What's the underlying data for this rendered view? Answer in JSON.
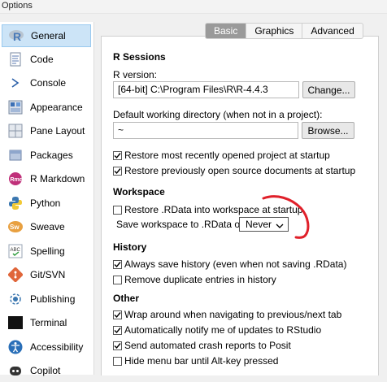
{
  "window": {
    "title": "Options"
  },
  "sidebar": {
    "items": [
      {
        "label": "General",
        "icon": "r-logo-icon",
        "selected": true
      },
      {
        "label": "Code",
        "icon": "code-document-icon"
      },
      {
        "label": "Console",
        "icon": "console-prompt-icon"
      },
      {
        "label": "Appearance",
        "icon": "appearance-palette-icon"
      },
      {
        "label": "Pane Layout",
        "icon": "pane-layout-icon"
      },
      {
        "label": "Packages",
        "icon": "package-box-icon"
      },
      {
        "label": "R Markdown",
        "icon": "rmd-icon"
      },
      {
        "label": "Python",
        "icon": "python-icon"
      },
      {
        "label": "Sweave",
        "icon": "sweave-icon"
      },
      {
        "label": "Spelling",
        "icon": "spelling-abc-icon"
      },
      {
        "label": "Git/SVN",
        "icon": "git-icon"
      },
      {
        "label": "Publishing",
        "icon": "publishing-icon"
      },
      {
        "label": "Terminal",
        "icon": "terminal-icon"
      },
      {
        "label": "Accessibility",
        "icon": "accessibility-icon"
      },
      {
        "label": "Copilot",
        "icon": "copilot-icon"
      }
    ]
  },
  "tabs": [
    {
      "label": "Basic",
      "active": true
    },
    {
      "label": "Graphics",
      "active": false
    },
    {
      "label": "Advanced",
      "active": false
    }
  ],
  "r_sessions": {
    "title": "R Sessions",
    "r_version_label": "R version:",
    "r_version_value": "[64-bit] C:\\Program Files\\R\\R-4.4.3",
    "change_button": "Change...",
    "working_dir_label": "Default working directory (when not in a project):",
    "working_dir_value": "~",
    "browse_button": "Browse...",
    "restore_project": {
      "label": "Restore most recently opened project at startup",
      "checked": true
    },
    "restore_documents": {
      "label": "Restore previously open source documents at startup",
      "checked": true
    }
  },
  "workspace": {
    "title": "Workspace",
    "restore_rdata": {
      "label": "Restore .RData into workspace at startup",
      "checked": false
    },
    "save_label": "Save workspace to .RData on exit:",
    "save_value": "Never"
  },
  "history": {
    "title": "History",
    "always_save": {
      "label": "Always save history (even when not saving .RData)",
      "checked": true
    },
    "remove_duplicates": {
      "label": "Remove duplicate entries in history",
      "checked": false
    }
  },
  "other": {
    "title": "Other",
    "wrap_around": {
      "label": "Wrap around when navigating to previous/next tab",
      "checked": true
    },
    "notify_updates": {
      "label": "Automatically notify me of updates to RStudio",
      "checked": true
    },
    "crash_reports": {
      "label": "Send automated crash reports to Posit",
      "checked": true
    },
    "hide_menu": {
      "label": "Hide menu bar until Alt-key pressed",
      "checked": false
    }
  },
  "colors": {
    "selected_bg": "#cce4f7",
    "annotation_red": "#e0202a",
    "active_tab": "#9a9a9a"
  }
}
